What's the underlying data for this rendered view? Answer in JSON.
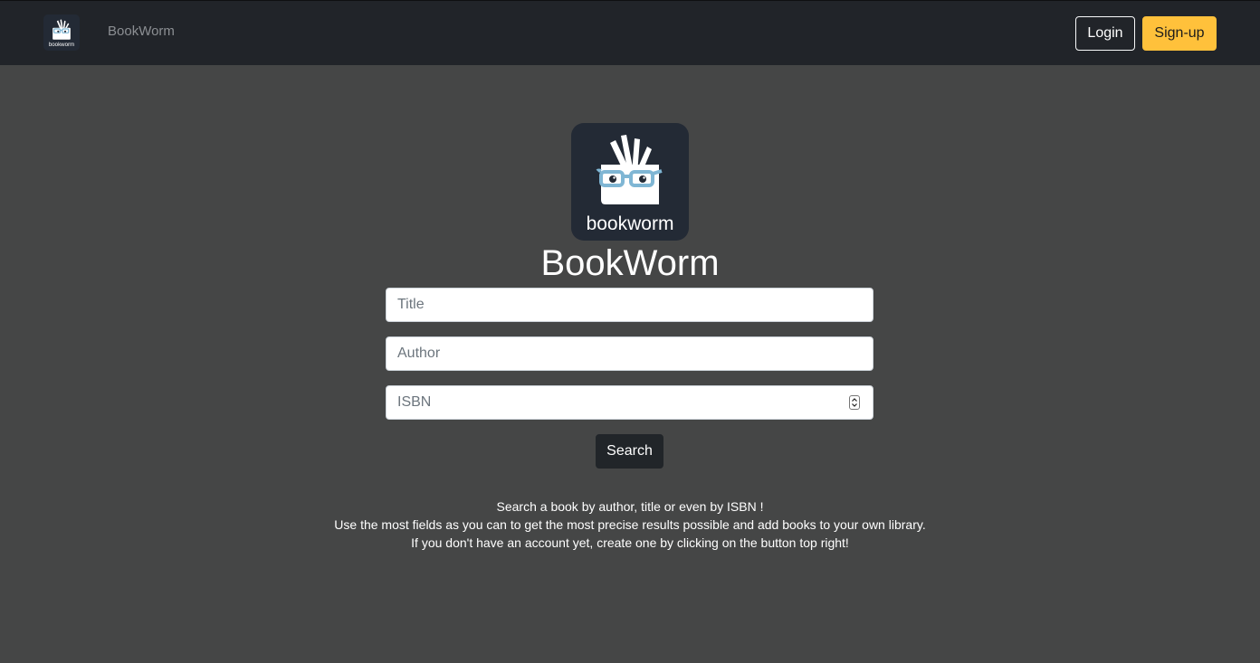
{
  "navbar": {
    "brand": "BookWorm",
    "logo_icon": "bookworm-logo-icon",
    "login_label": "Login",
    "signup_label": "Sign-up"
  },
  "hero": {
    "logo_icon": "bookworm-logo-icon",
    "logo_text": "bookworm",
    "title": "BookWorm"
  },
  "search": {
    "title_placeholder": "Title",
    "author_placeholder": "Author",
    "isbn_placeholder": "ISBN",
    "button_label": "Search"
  },
  "info": {
    "line1": "Search a book by author, title or even by ISBN !",
    "line2": "Use the most fields as you can to get the most precise results possible and add books to your own library.",
    "line3": "If you don't have an account yet, create one by clicking on the button top right!"
  },
  "colors": {
    "page_background": "#454646",
    "navbar_background": "#212429",
    "signup_accent": "#ffc13b",
    "logo_background": "#232a35",
    "glasses_color": "#7fb6d4"
  }
}
